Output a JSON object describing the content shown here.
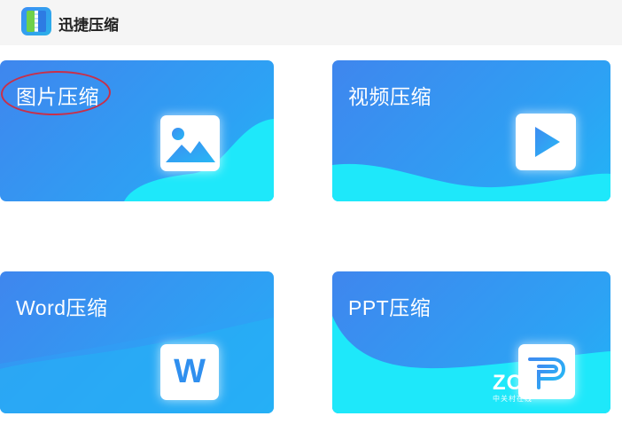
{
  "app": {
    "title": "迅捷压缩",
    "logo_icon": "zipper-archive-icon"
  },
  "cards": {
    "image": {
      "label": "图片压缩",
      "icon": "image-icon"
    },
    "video": {
      "label": "视频压缩",
      "icon": "play-icon"
    },
    "word": {
      "label": "Word压缩",
      "icon": "word-doc-icon",
      "icon_text": "W"
    },
    "ppt": {
      "label": "PPT压缩",
      "icon": "ppt-icon"
    }
  },
  "annotation": {
    "highlight_color": "#c8304a"
  },
  "watermark": {
    "logo": "ZOL",
    "subtitle": "中关村在线"
  },
  "colors": {
    "card_blue": "#3f86ee",
    "card_cyan": "#1ee8fa",
    "text_dark": "#222222"
  }
}
